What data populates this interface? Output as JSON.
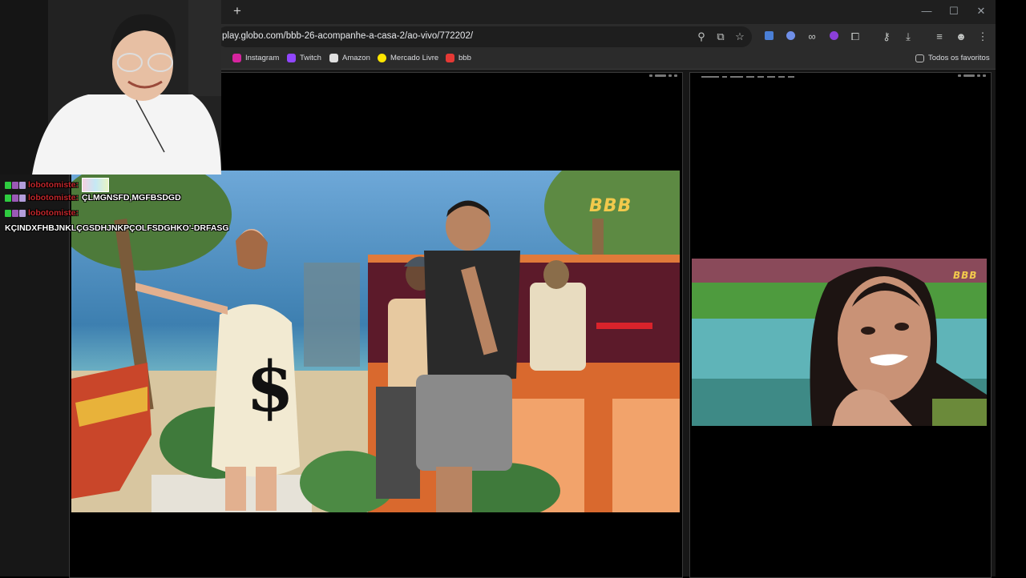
{
  "browser": {
    "url": "play.globo.com/bbb-26-acompanhe-a-casa-2/ao-vivo/772202/",
    "new_tab_symbol": "+",
    "window_controls": [
      "—",
      "☐",
      "✕"
    ],
    "bookmarks": [
      {
        "label": "Instagram",
        "color": "#d6249f"
      },
      {
        "label": "Twitch",
        "color": "#9146ff"
      },
      {
        "label": "Amazon",
        "color": "#e0e0e0"
      },
      {
        "label": "Mercado Livre",
        "color": "#ffe600"
      },
      {
        "label": "bbb",
        "color": "#e53935"
      }
    ],
    "all_bookmarks": "Todos os favoritos"
  },
  "videos": {
    "left_logo": "BBB",
    "right_logo": "BBB"
  },
  "chat": {
    "messages": [
      {
        "user": "lobotomiste:",
        "text": "",
        "emote": true
      },
      {
        "user": "lobotomiste:",
        "text": "ÇLMGNSFD,MGFBSDGD",
        "emote": false
      },
      {
        "user": "lobotomiste:",
        "text": "",
        "emote": false
      }
    ],
    "continuation": "KÇINDXFHBJNKLÇGSDHJNKPÇOLFSDGHKO'-DRFASG"
  },
  "colors": {
    "accent_logo": "#f2c94c",
    "chat_username": "#c0262b"
  }
}
